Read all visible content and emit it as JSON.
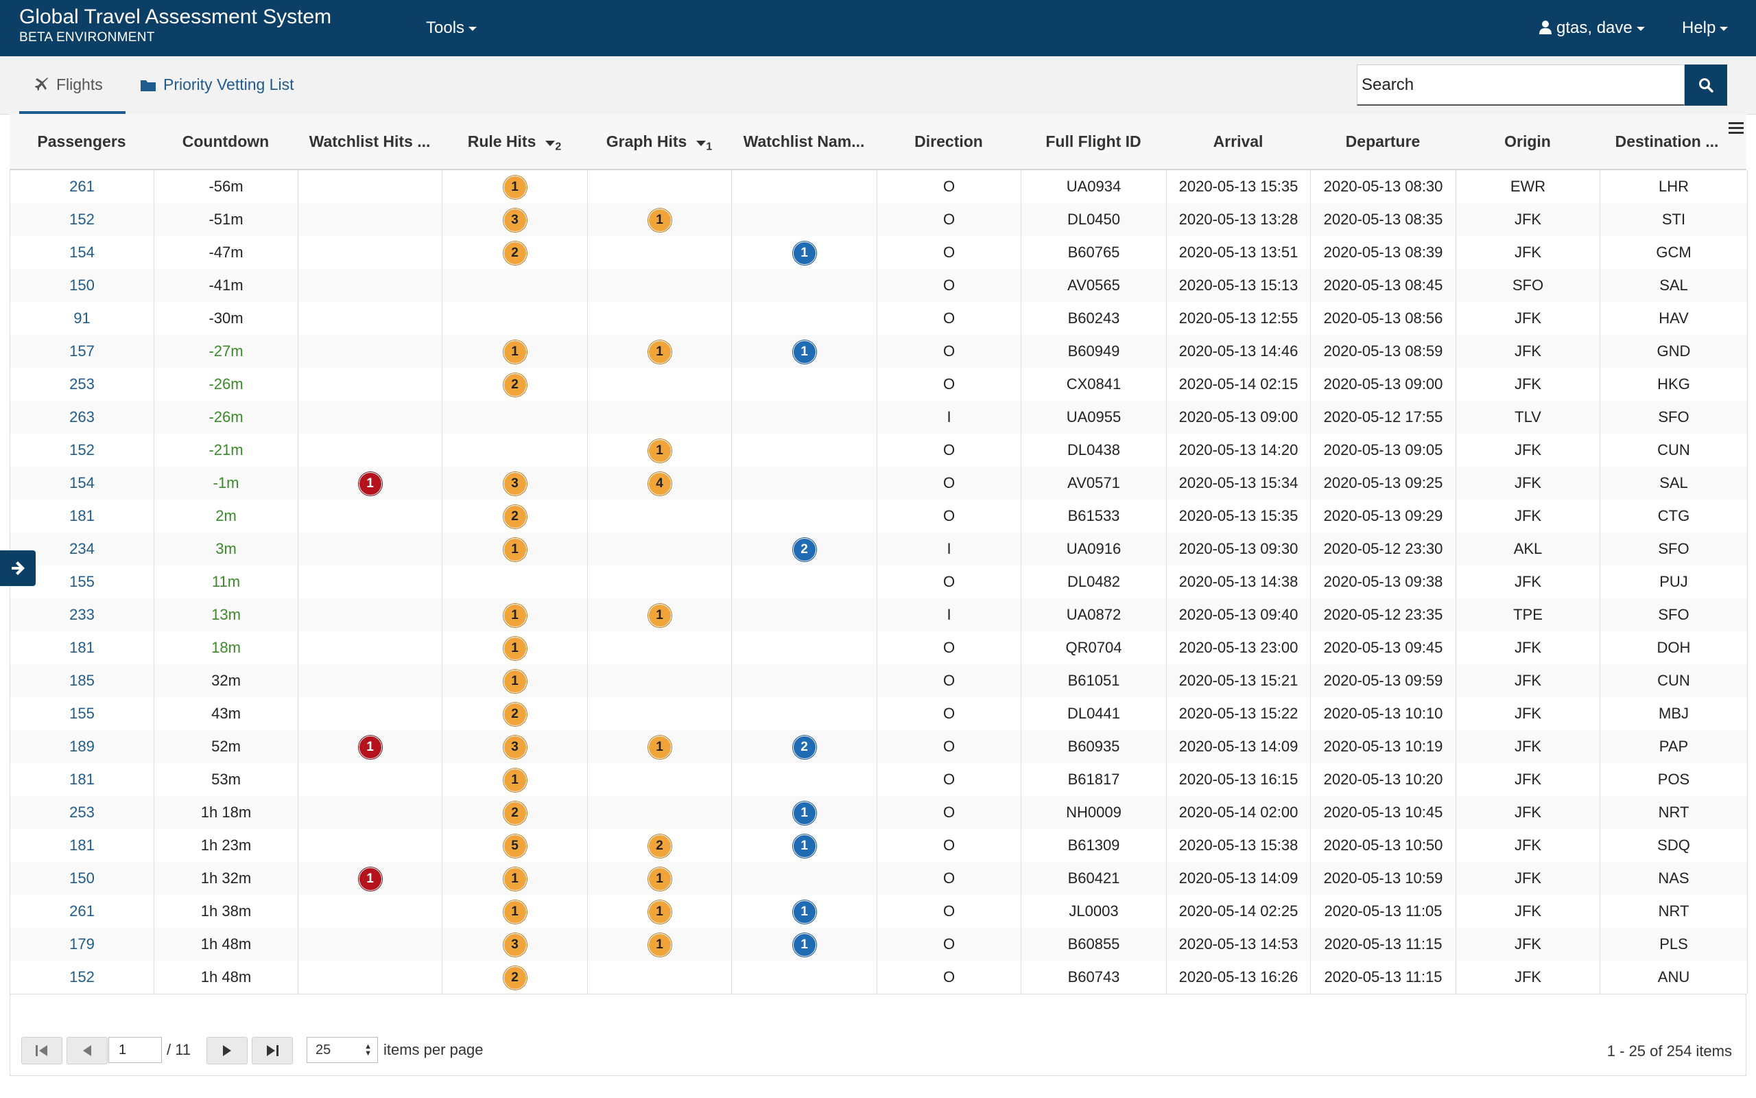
{
  "app": {
    "title": "Global Travel Assessment System",
    "subtitle": "BETA ENVIRONMENT"
  },
  "nav": {
    "tools": "Tools",
    "user": "gtas, dave",
    "help": "Help"
  },
  "tabs": {
    "flights": "Flights",
    "priority": "Priority Vetting List"
  },
  "search": {
    "placeholder": "Search"
  },
  "columns": {
    "passengers": "Passengers",
    "countdown": "Countdown",
    "watchlist_hits": "Watchlist Hits ...",
    "rule_hits": "Rule Hits",
    "rule_hits_sort": "2",
    "graph_hits": "Graph Hits",
    "graph_hits_sort": "1",
    "watchlist_names": "Watchlist Nam...",
    "direction": "Direction",
    "full_flight_id": "Full Flight ID",
    "arrival": "Arrival",
    "departure": "Departure",
    "origin": "Origin",
    "destination": "Destination ..."
  },
  "rows": [
    {
      "pax": "261",
      "cd": "-56m",
      "cdc": "",
      "wl": "",
      "rule": "1",
      "graph": "",
      "wn": "",
      "dir": "O",
      "fid": "UA0934",
      "arr": "2020-05-13 15:35",
      "dep": "2020-05-13 08:30",
      "org": "EWR",
      "dst": "LHR"
    },
    {
      "pax": "152",
      "cd": "-51m",
      "cdc": "",
      "wl": "",
      "rule": "3",
      "graph": "1",
      "wn": "",
      "dir": "O",
      "fid": "DL0450",
      "arr": "2020-05-13 13:28",
      "dep": "2020-05-13 08:35",
      "org": "JFK",
      "dst": "STI"
    },
    {
      "pax": "154",
      "cd": "-47m",
      "cdc": "",
      "wl": "",
      "rule": "2",
      "graph": "",
      "wn": "1",
      "dir": "O",
      "fid": "B60765",
      "arr": "2020-05-13 13:51",
      "dep": "2020-05-13 08:39",
      "org": "JFK",
      "dst": "GCM"
    },
    {
      "pax": "150",
      "cd": "-41m",
      "cdc": "",
      "wl": "",
      "rule": "",
      "graph": "",
      "wn": "",
      "dir": "O",
      "fid": "AV0565",
      "arr": "2020-05-13 15:13",
      "dep": "2020-05-13 08:45",
      "org": "SFO",
      "dst": "SAL"
    },
    {
      "pax": "91",
      "cd": "-30m",
      "cdc": "",
      "wl": "",
      "rule": "",
      "graph": "",
      "wn": "",
      "dir": "O",
      "fid": "B60243",
      "arr": "2020-05-13 12:55",
      "dep": "2020-05-13 08:56",
      "org": "JFK",
      "dst": "HAV"
    },
    {
      "pax": "157",
      "cd": "-27m",
      "cdc": "green",
      "wl": "",
      "rule": "1",
      "graph": "1",
      "wn": "1",
      "dir": "O",
      "fid": "B60949",
      "arr": "2020-05-13 14:46",
      "dep": "2020-05-13 08:59",
      "org": "JFK",
      "dst": "GND"
    },
    {
      "pax": "253",
      "cd": "-26m",
      "cdc": "green",
      "wl": "",
      "rule": "2",
      "graph": "",
      "wn": "",
      "dir": "O",
      "fid": "CX0841",
      "arr": "2020-05-14 02:15",
      "dep": "2020-05-13 09:00",
      "org": "JFK",
      "dst": "HKG"
    },
    {
      "pax": "263",
      "cd": "-26m",
      "cdc": "green",
      "wl": "",
      "rule": "",
      "graph": "",
      "wn": "",
      "dir": "I",
      "fid": "UA0955",
      "arr": "2020-05-13 09:00",
      "dep": "2020-05-12 17:55",
      "org": "TLV",
      "dst": "SFO"
    },
    {
      "pax": "152",
      "cd": "-21m",
      "cdc": "green",
      "wl": "",
      "rule": "",
      "graph": "1",
      "wn": "",
      "dir": "O",
      "fid": "DL0438",
      "arr": "2020-05-13 14:20",
      "dep": "2020-05-13 09:05",
      "org": "JFK",
      "dst": "CUN"
    },
    {
      "pax": "154",
      "cd": "-1m",
      "cdc": "green",
      "wl": "1",
      "rule": "3",
      "graph": "4",
      "wn": "",
      "dir": "O",
      "fid": "AV0571",
      "arr": "2020-05-13 15:34",
      "dep": "2020-05-13 09:25",
      "org": "JFK",
      "dst": "SAL"
    },
    {
      "pax": "181",
      "cd": "2m",
      "cdc": "green",
      "wl": "",
      "rule": "2",
      "graph": "",
      "wn": "",
      "dir": "O",
      "fid": "B61533",
      "arr": "2020-05-13 15:35",
      "dep": "2020-05-13 09:29",
      "org": "JFK",
      "dst": "CTG"
    },
    {
      "pax": "234",
      "cd": "3m",
      "cdc": "green",
      "wl": "",
      "rule": "1",
      "graph": "",
      "wn": "2",
      "dir": "I",
      "fid": "UA0916",
      "arr": "2020-05-13 09:30",
      "dep": "2020-05-12 23:30",
      "org": "AKL",
      "dst": "SFO"
    },
    {
      "pax": "155",
      "cd": "11m",
      "cdc": "green",
      "wl": "",
      "rule": "",
      "graph": "",
      "wn": "",
      "dir": "O",
      "fid": "DL0482",
      "arr": "2020-05-13 14:38",
      "dep": "2020-05-13 09:38",
      "org": "JFK",
      "dst": "PUJ"
    },
    {
      "pax": "233",
      "cd": "13m",
      "cdc": "green",
      "wl": "",
      "rule": "1",
      "graph": "1",
      "wn": "",
      "dir": "I",
      "fid": "UA0872",
      "arr": "2020-05-13 09:40",
      "dep": "2020-05-12 23:35",
      "org": "TPE",
      "dst": "SFO"
    },
    {
      "pax": "181",
      "cd": "18m",
      "cdc": "green",
      "wl": "",
      "rule": "1",
      "graph": "",
      "wn": "",
      "dir": "O",
      "fid": "QR0704",
      "arr": "2020-05-13 23:00",
      "dep": "2020-05-13 09:45",
      "org": "JFK",
      "dst": "DOH"
    },
    {
      "pax": "185",
      "cd": "32m",
      "cdc": "",
      "wl": "",
      "rule": "1",
      "graph": "",
      "wn": "",
      "dir": "O",
      "fid": "B61051",
      "arr": "2020-05-13 15:21",
      "dep": "2020-05-13 09:59",
      "org": "JFK",
      "dst": "CUN"
    },
    {
      "pax": "155",
      "cd": "43m",
      "cdc": "",
      "wl": "",
      "rule": "2",
      "graph": "",
      "wn": "",
      "dir": "O",
      "fid": "DL0441",
      "arr": "2020-05-13 15:22",
      "dep": "2020-05-13 10:10",
      "org": "JFK",
      "dst": "MBJ"
    },
    {
      "pax": "189",
      "cd": "52m",
      "cdc": "",
      "wl": "1",
      "rule": "3",
      "graph": "1",
      "wn": "2",
      "dir": "O",
      "fid": "B60935",
      "arr": "2020-05-13 14:09",
      "dep": "2020-05-13 10:19",
      "org": "JFK",
      "dst": "PAP"
    },
    {
      "pax": "181",
      "cd": "53m",
      "cdc": "",
      "wl": "",
      "rule": "1",
      "graph": "",
      "wn": "",
      "dir": "O",
      "fid": "B61817",
      "arr": "2020-05-13 16:15",
      "dep": "2020-05-13 10:20",
      "org": "JFK",
      "dst": "POS"
    },
    {
      "pax": "253",
      "cd": "1h 18m",
      "cdc": "",
      "wl": "",
      "rule": "2",
      "graph": "",
      "wn": "1",
      "dir": "O",
      "fid": "NH0009",
      "arr": "2020-05-14 02:00",
      "dep": "2020-05-13 10:45",
      "org": "JFK",
      "dst": "NRT"
    },
    {
      "pax": "181",
      "cd": "1h 23m",
      "cdc": "",
      "wl": "",
      "rule": "5",
      "graph": "2",
      "wn": "1",
      "dir": "O",
      "fid": "B61309",
      "arr": "2020-05-13 15:38",
      "dep": "2020-05-13 10:50",
      "org": "JFK",
      "dst": "SDQ"
    },
    {
      "pax": "150",
      "cd": "1h 32m",
      "cdc": "",
      "wl": "1",
      "rule": "1",
      "graph": "1",
      "wn": "",
      "dir": "O",
      "fid": "B60421",
      "arr": "2020-05-13 14:09",
      "dep": "2020-05-13 10:59",
      "org": "JFK",
      "dst": "NAS"
    },
    {
      "pax": "261",
      "cd": "1h 38m",
      "cdc": "",
      "wl": "",
      "rule": "1",
      "graph": "1",
      "wn": "1",
      "dir": "O",
      "fid": "JL0003",
      "arr": "2020-05-14 02:25",
      "dep": "2020-05-13 11:05",
      "org": "JFK",
      "dst": "NRT"
    },
    {
      "pax": "179",
      "cd": "1h 48m",
      "cdc": "",
      "wl": "",
      "rule": "3",
      "graph": "1",
      "wn": "1",
      "dir": "O",
      "fid": "B60855",
      "arr": "2020-05-13 14:53",
      "dep": "2020-05-13 11:15",
      "org": "JFK",
      "dst": "PLS"
    },
    {
      "pax": "152",
      "cd": "1h 48m",
      "cdc": "",
      "wl": "",
      "rule": "2",
      "graph": "",
      "wn": "",
      "dir": "O",
      "fid": "B60743",
      "arr": "2020-05-13 16:26",
      "dep": "2020-05-13 11:15",
      "org": "JFK",
      "dst": "ANU"
    }
  ],
  "pager": {
    "page": "1",
    "of_pages": "/ 11",
    "page_size": "25",
    "items_per_page_label": "items per page",
    "info": "1 - 25 of 254 items"
  },
  "colors": {
    "navbar": "#0c3f66",
    "rule_badge": "#f0a43a",
    "watchlist_badge": "#b5131b",
    "watchlist_name_badge": "#1f6bb4",
    "countdown_recent": "#3b8a2b",
    "link": "#1f5b8c"
  },
  "icons": {
    "user": "user-icon",
    "flights_tab": "plane-icon",
    "priority_tab": "folder-icon",
    "search": "search-icon",
    "column_menu": "hamburger-icon",
    "side_toggle": "arrow-right-icon"
  }
}
